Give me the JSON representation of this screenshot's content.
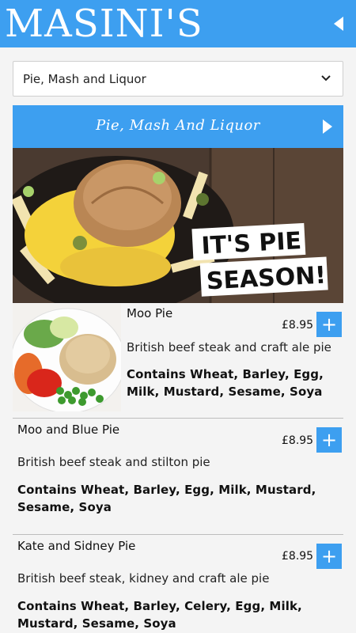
{
  "header": {
    "brand": "MASINI'S",
    "back_icon": "chevron-left-icon"
  },
  "category_select": {
    "selected": "Pie, Mash and Liquor"
  },
  "category_bar": {
    "title": "Pie, Mash And Liquor"
  },
  "banner": {
    "line1": "IT'S PIE",
    "line2": "SEASON!"
  },
  "items": [
    {
      "name": "Moo Pie",
      "price": "£8.95",
      "description": "British beef steak and craft ale pie",
      "allergens": "Contains Wheat, Barley, Egg, Milk, Mustard, Sesame, Soya",
      "add_label": "+"
    },
    {
      "name": "Moo and Blue Pie",
      "price": "£8.95",
      "description": "British beef steak and stilton pie",
      "allergens": "Contains Wheat, Barley, Egg, Milk, Mustard, Sesame, Soya",
      "add_label": "+"
    },
    {
      "name": "Kate and Sidney Pie",
      "price": "£8.95",
      "description": "British beef steak, kidney and craft ale pie",
      "allergens": "Contains Wheat, Barley, Celery, Egg, Milk, Mustard, Sesame, Soya",
      "add_label": "+"
    }
  ],
  "colors": {
    "accent": "#3d9ff0"
  }
}
